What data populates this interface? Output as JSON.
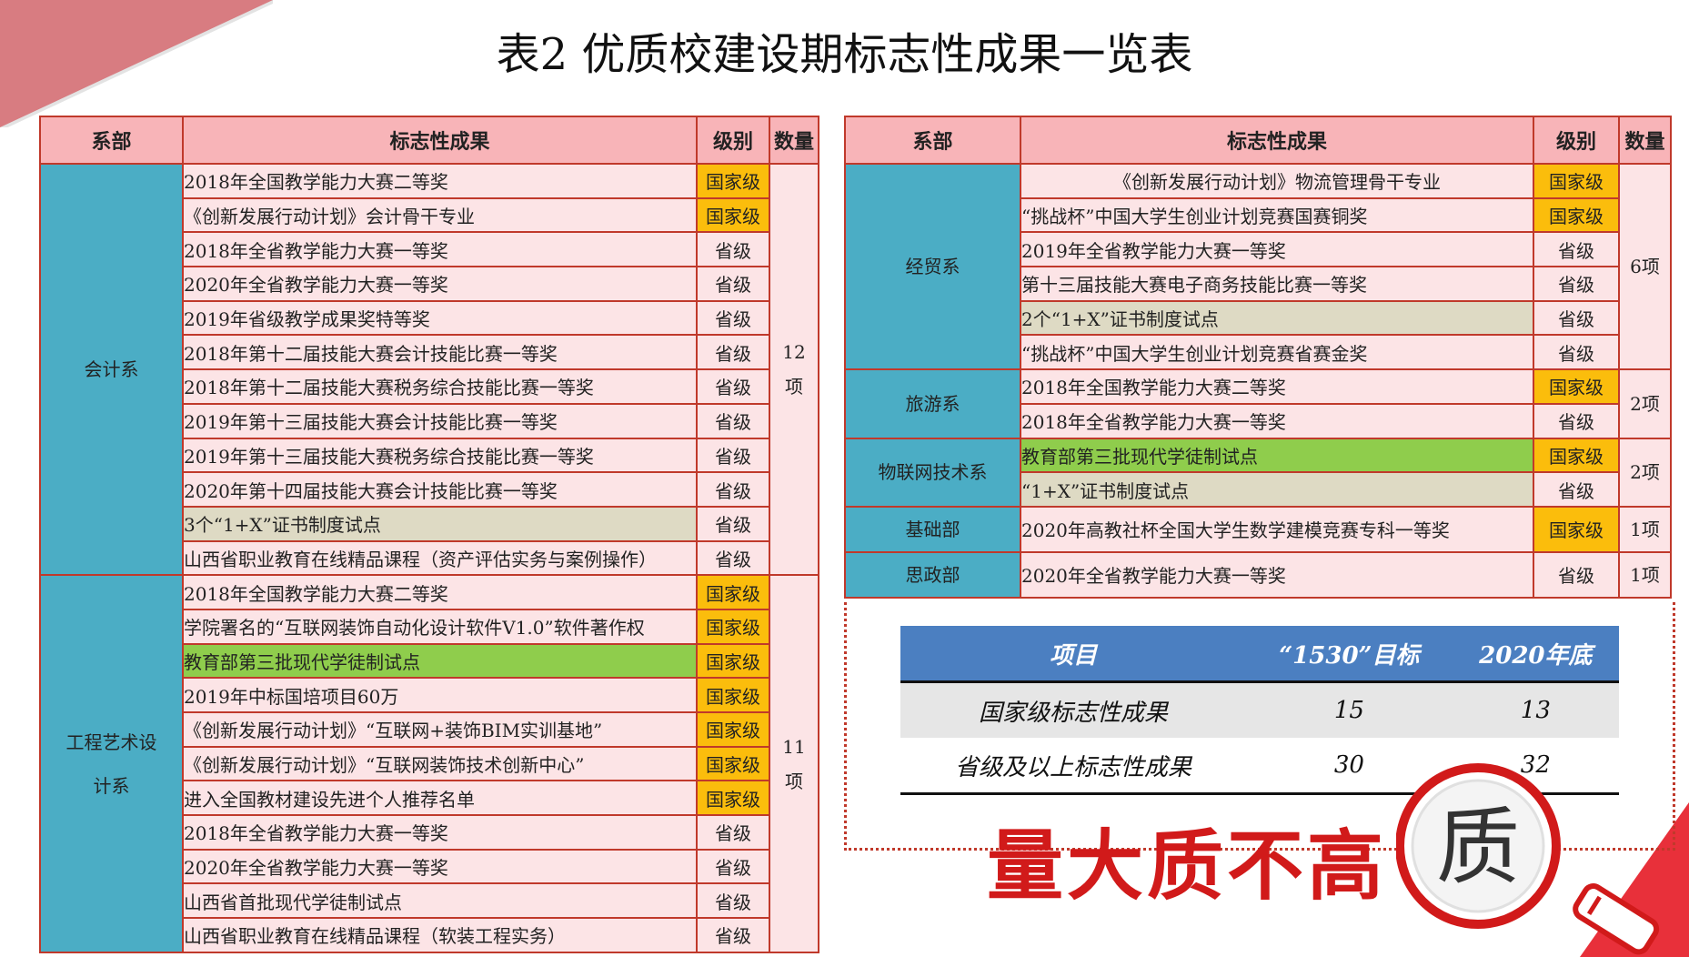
{
  "title": "表2 优质校建设期标志性成果一览表",
  "headers": {
    "dept": "系部",
    "achievement": "标志性成果",
    "level": "级别",
    "count": "数量"
  },
  "left": {
    "groups": [
      {
        "dept": "会计系",
        "count": "12\n项",
        "rows": [
          {
            "text": "2018年全国教学能力大赛二等奖",
            "level": "国家级"
          },
          {
            "text": "《创新发展行动计划》会计骨干专业",
            "level": "国家级"
          },
          {
            "text": "2018年全省教学能力大赛一等奖",
            "level": "省级"
          },
          {
            "text": "2020年全省教学能力大赛一等奖",
            "level": "省级"
          },
          {
            "text": "2019年省级教学成果奖特等奖",
            "level": "省级"
          },
          {
            "text": "2018年第十二届技能大赛会计技能比赛一等奖",
            "level": "省级"
          },
          {
            "text": "2018年第十二届技能大赛税务综合技能比赛一等奖",
            "level": "省级"
          },
          {
            "text": "2019年第十三届技能大赛会计技能比赛一等奖",
            "level": "省级"
          },
          {
            "text": "2019年第十三届技能大赛税务综合技能比赛一等奖",
            "level": "省级"
          },
          {
            "text": "2020年第十四届技能大赛会计技能比赛一等奖",
            "level": "省级"
          },
          {
            "text": "3个“1+X”证书制度试点",
            "level": "省级"
          },
          {
            "text": "山西省职业教育在线精品课程（资产评估实务与案例操作）",
            "level": "省级"
          }
        ]
      },
      {
        "dept": "工程艺术设\n计系",
        "count": "11\n项",
        "rows": [
          {
            "text": "2018年全国教学能力大赛二等奖",
            "level": "国家级"
          },
          {
            "text": "学院署名的“互联网装饰自动化设计软件V1.0”软件著作权",
            "level": "国家级"
          },
          {
            "text": "教育部第三批现代学徒制试点",
            "level": "国家级"
          },
          {
            "text": "2019年中标国培项目60万",
            "level": "国家级"
          },
          {
            "text": "《创新发展行动计划》“互联网+装饰BIM实训基地”",
            "level": "国家级"
          },
          {
            "text": "《创新发展行动计划》“互联网装饰技术创新中心”",
            "level": "国家级"
          },
          {
            "text": "进入全国教材建设先进个人推荐名单",
            "level": "国家级"
          },
          {
            "text": "2018年全省教学能力大赛一等奖",
            "level": "省级"
          },
          {
            "text": "2020年全省教学能力大赛一等奖",
            "level": "省级"
          },
          {
            "text": "山西省首批现代学徒制试点",
            "level": "省级"
          },
          {
            "text": "山西省职业教育在线精品课程（软装工程实务）",
            "level": "省级"
          }
        ]
      }
    ]
  },
  "right": {
    "groups": [
      {
        "dept": "经贸系",
        "count": "6项",
        "rows": [
          {
            "text": "《创新发展行动计划》物流管理骨干专业",
            "level": "国家级"
          },
          {
            "text": "“挑战杯”中国大学生创业计划竞赛国赛铜奖",
            "level": "国家级"
          },
          {
            "text": "2019年全省教学能力大赛一等奖",
            "level": "省级"
          },
          {
            "text": "第十三届技能大赛电子商务技能比赛一等奖",
            "level": "省级"
          },
          {
            "text": "2个“1+X”证书制度试点",
            "level": "省级"
          },
          {
            "text": "“挑战杯”中国大学生创业计划竞赛省赛金奖",
            "level": "省级"
          }
        ]
      },
      {
        "dept": "旅游系",
        "count": "2项",
        "rows": [
          {
            "text": "2018年全国教学能力大赛二等奖",
            "level": "国家级"
          },
          {
            "text": "2018年全省教学能力大赛一等奖",
            "level": "省级"
          }
        ]
      },
      {
        "dept": "物联网技术系",
        "count": "2项",
        "rows": [
          {
            "text": "教育部第三批现代学徒制试点",
            "level": "国家级"
          },
          {
            "text": "“1+X”证书制度试点",
            "level": "省级"
          }
        ]
      },
      {
        "dept": "基础部",
        "count": "1项",
        "rows": [
          {
            "text": "2020年高教社杯全国大学生数学建模竞赛专科一等奖",
            "level": "国家级"
          }
        ]
      },
      {
        "dept": "思政部",
        "count": "1项",
        "rows": [
          {
            "text": "2020年全省教学能力大赛一等奖",
            "level": "省级"
          }
        ]
      }
    ]
  },
  "summary": {
    "headers": [
      "项目",
      "“1530”目标",
      "2020年底"
    ],
    "rows": [
      [
        "国家级标志性成果",
        "15",
        "13"
      ],
      [
        "省级及以上标志性成果",
        "30",
        "32"
      ]
    ]
  },
  "slogan": "量大质不高",
  "magnifier_char": "质",
  "colors": {
    "national": "#fbbd0c",
    "dept": "#4badc5",
    "header": "#f8b4b8",
    "green": "#8fcd4c",
    "tan": "#dedac4",
    "accent": "#d11a1a"
  }
}
